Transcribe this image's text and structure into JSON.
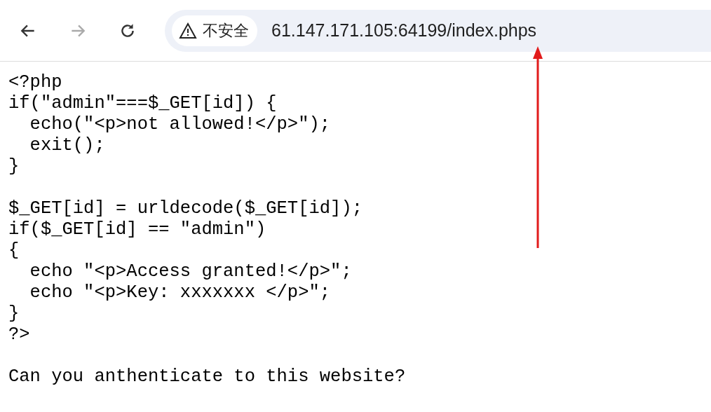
{
  "toolbar": {
    "security_label": "不安全",
    "url": "61.147.171.105:64199/index.phps",
    "forward_disabled": true
  },
  "page": {
    "code_blocks": [
      [
        "<?php",
        "if(\"admin\"===$_GET[id]) {",
        "  echo(\"<p>not allowed!</p>\");",
        "  exit();",
        "}"
      ],
      [
        "$_GET[id] = urldecode($_GET[id]);",
        "if($_GET[id] == \"admin\")",
        "{",
        "  echo \"<p>Access granted!</p>\";",
        "  echo \"<p>Key: xxxxxxx </p>\";",
        "}",
        "?>"
      ],
      [
        "Can you anthenticate to this website?"
      ]
    ]
  }
}
